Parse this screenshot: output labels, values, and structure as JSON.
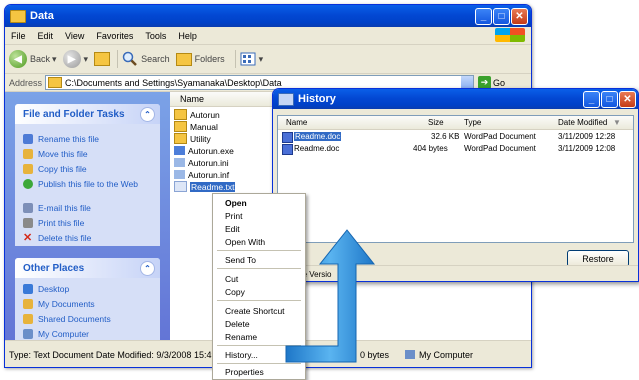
{
  "main_window": {
    "title": "Data",
    "menu": [
      "File",
      "Edit",
      "View",
      "Favorites",
      "Tools",
      "Help"
    ],
    "toolbar": {
      "back": "Back",
      "search": "Search",
      "folders": "Folders"
    },
    "address": {
      "label": "Address",
      "value": "C:\\Documents and Settings\\Syamanaka\\Desktop\\Data",
      "go": "Go"
    },
    "task_pane": {
      "file_tasks": {
        "title": "File and Folder Tasks",
        "items": [
          "Rename this file",
          "Move this file",
          "Copy this file",
          "Publish this file to the Web",
          "E-mail this file",
          "Print this file",
          "Delete this file"
        ]
      },
      "other_places": {
        "title": "Other Places",
        "items": [
          "Desktop",
          "My Documents",
          "Shared Documents",
          "My Computer"
        ]
      }
    },
    "file_list": {
      "column_name": "Name",
      "files": [
        "Autorun",
        "Manual",
        "Utility",
        "Autorun.exe",
        "Autorun.ini",
        "Autorun.inf",
        "Readme.txt"
      ]
    },
    "status": {
      "text": "Type: Text Document Date Modified: 9/3/2008 15:49 S",
      "size": "0 bytes",
      "location": "My Computer"
    }
  },
  "context_menu": {
    "items": [
      "Open",
      "Print",
      "Edit",
      "Open With",
      "Send To",
      "Cut",
      "Copy",
      "Create Shortcut",
      "Delete",
      "Rename",
      "History...",
      "Properties"
    ]
  },
  "history_window": {
    "title": "History",
    "columns": {
      "name": "Name",
      "size": "Size",
      "type": "Type",
      "date": "Date Modified"
    },
    "rows": [
      {
        "name": "Readme.doc",
        "size": "32.6 KB",
        "type": "WordPad Document",
        "date": "3/11/2009 12:28"
      },
      {
        "name": "Readme.doc",
        "size": "404 bytes",
        "type": "WordPad Document",
        "date": "3/11/2009 12:08"
      }
    ],
    "restore": "Restore",
    "status": "2 Unique Versio"
  },
  "colors": {
    "xp_blue": "#0348d3",
    "taskpane": "#7ba2e7",
    "arrow": "#2f8fd8",
    "selection": "#316ac5"
  }
}
